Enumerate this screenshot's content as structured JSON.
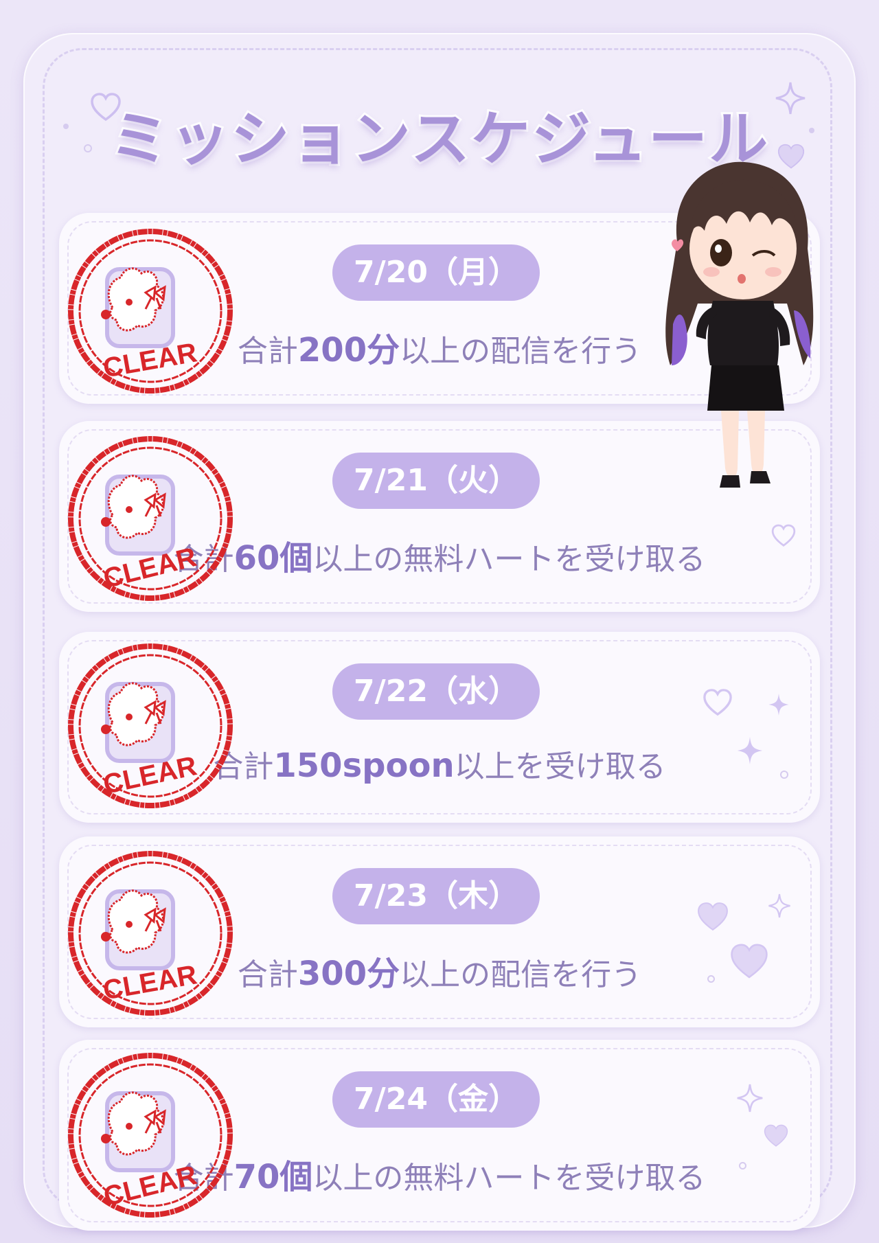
{
  "title": "ミッションスケジュール",
  "colors": {
    "accent": "#a893d8",
    "pill": "#c4b2ea",
    "text": "#8e80b8",
    "stamp": "#d8262a",
    "background": "#ece6f8"
  },
  "stamp_label": "CLEAR",
  "missions": [
    {
      "date": "7/20（月）",
      "pre": "合計",
      "num": "200分",
      "post": "以上の配信を行う",
      "status": "CLEAR"
    },
    {
      "date": "7/21（火）",
      "pre": "合計",
      "num": "60個",
      "post": "以上の無料ハートを受け取る",
      "status": "CLEAR"
    },
    {
      "date": "7/22（水）",
      "pre": "合計",
      "num": "150spoon",
      "post": "以上を受け取る",
      "status": "CLEAR"
    },
    {
      "date": "7/23（木）",
      "pre": "合計",
      "num": "300分",
      "post": "以上の配信を行う",
      "status": "CLEAR"
    },
    {
      "date": "7/24（金）",
      "pre": "合計",
      "num": "70個",
      "post": "以上の無料ハートを受け取る",
      "status": "CLEAR"
    }
  ],
  "icons": {
    "stamp": "poodle-with-bow-icon",
    "heart": "heart-icon",
    "sparkle": "sparkle-icon",
    "character": "chibi-girl-illustration"
  }
}
